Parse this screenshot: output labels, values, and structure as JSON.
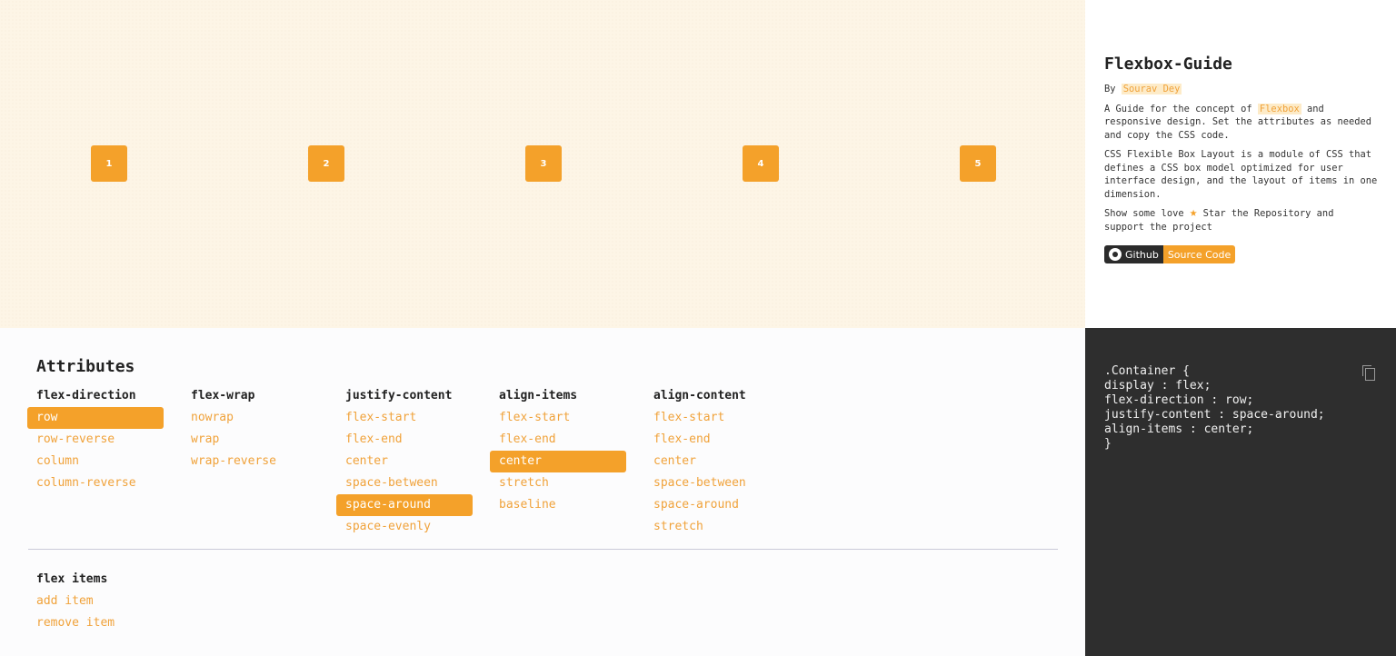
{
  "preview": {
    "boxes": [
      "1",
      "2",
      "3",
      "4",
      "5"
    ]
  },
  "info": {
    "title": "Flexbox-Guide",
    "by_prefix": "By",
    "author": "Sourav Dey",
    "desc1_a": "A Guide for the concept of",
    "desc1_hl": "Flexbox",
    "desc1_b": "and responsive design. Set the attributes as needed and copy the CSS code.",
    "desc2": "CSS Flexible Box Layout is a module of CSS that defines a CSS box model optimized for user interface design, and the layout of items in one dimension.",
    "love_a": "Show some love",
    "star": "★",
    "love_b": "Star the Repository and support the project",
    "badge_left": "Github",
    "badge_right": "Source Code"
  },
  "code": {
    "lines": [
      ".Container {",
      "display : flex;",
      "flex-direction : row;",
      "justify-content : space-around;",
      "align-items : center;",
      "}"
    ]
  },
  "attributes": {
    "title": "Attributes",
    "columns": [
      {
        "title": "flex-direction",
        "options": [
          "row",
          "row-reverse",
          "column",
          "column-reverse"
        ],
        "active": "row"
      },
      {
        "title": "flex-wrap",
        "options": [
          "nowrap",
          "wrap",
          "wrap-reverse"
        ],
        "active": ""
      },
      {
        "title": "justify-content",
        "options": [
          "flex-start",
          "flex-end",
          "center",
          "space-between",
          "space-around",
          "space-evenly"
        ],
        "active": "space-around"
      },
      {
        "title": "align-items",
        "options": [
          "flex-start",
          "flex-end",
          "center",
          "stretch",
          "baseline"
        ],
        "active": "center"
      },
      {
        "title": "align-content",
        "options": [
          "flex-start",
          "flex-end",
          "center",
          "space-between",
          "space-around",
          "stretch"
        ],
        "active": ""
      }
    ],
    "items": {
      "title": "flex items",
      "options": [
        "add item",
        "remove item"
      ]
    }
  },
  "colors": {
    "accent": "#f4a12a",
    "preview_bg": "#fdf5e6",
    "code_bg": "#2e2e2e"
  }
}
